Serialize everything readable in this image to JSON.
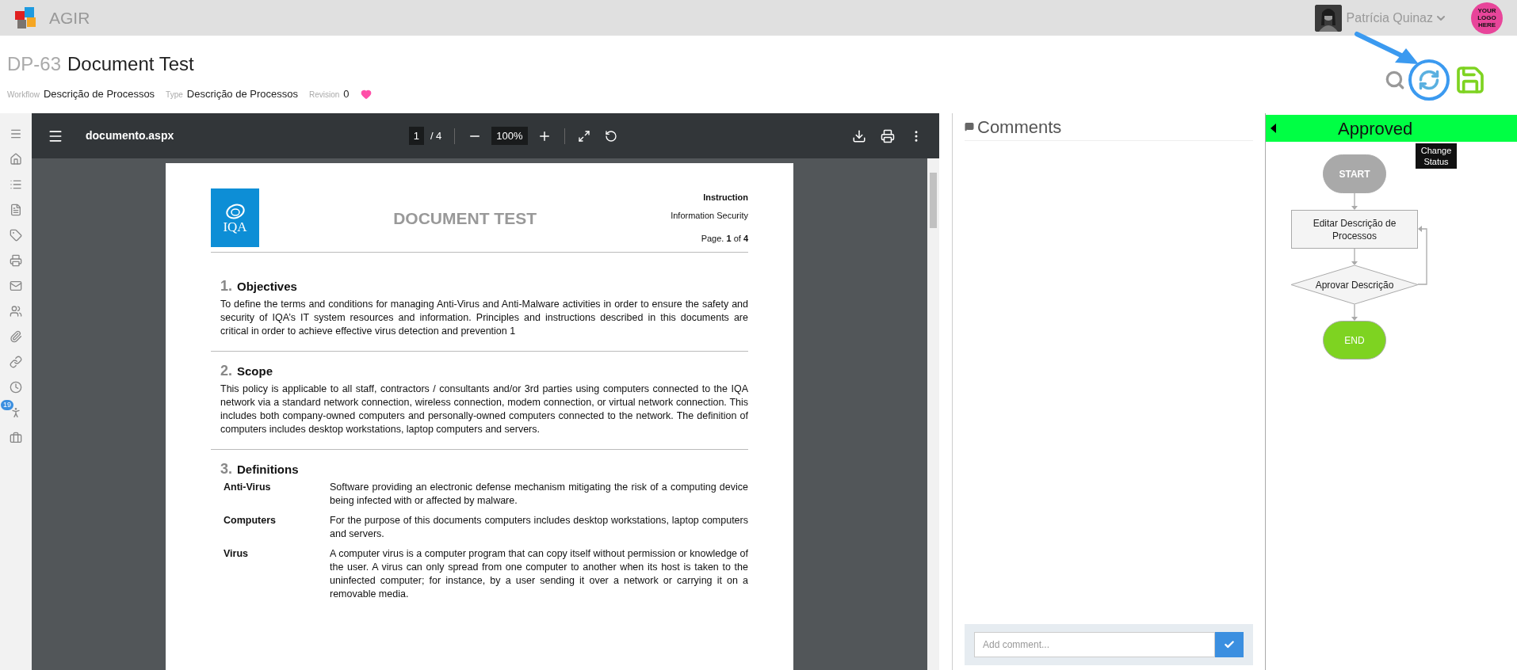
{
  "app": {
    "name": "AGIR"
  },
  "user": {
    "name": "Patrícia Quinaz"
  },
  "company_logo": {
    "lines": [
      "YOUR",
      "LOGO",
      "HERE"
    ]
  },
  "document": {
    "code": "DP-63",
    "title": "Document Test",
    "favorite": true,
    "meta": [
      {
        "label": "Workflow",
        "value": "Descrição de Processos"
      },
      {
        "label": "Type",
        "value": "Descrição de Processos"
      },
      {
        "label": "Revision",
        "value": "0"
      }
    ]
  },
  "actions": {
    "tooltip": "Change Status"
  },
  "sidebar": {
    "badge": "19"
  },
  "pdf_viewer": {
    "file_name": "documento.aspx",
    "page": "1",
    "page_count": "/ 4",
    "zoom": "100%"
  },
  "pdf_page": {
    "logo_text": "IQA",
    "title": "DOCUMENT TEST",
    "category": "Instruction",
    "subject": "Information Security",
    "page_label": "Page. **1** of **4**",
    "sections": [
      {
        "kind": "paragraph",
        "number": "1.",
        "title": "Objectives",
        "text": "To define the terms and conditions for managing Anti-Virus and Anti-Malware activities in order to ensure the safety and security of IQA’s IT system resources and information. Principles and instructions described in this documents are critical in order to achieve effective virus detection and prevention 1"
      },
      {
        "kind": "paragraph",
        "number": "2.",
        "title": "Scope",
        "text": "This policy is applicable to all staff, contractors / consultants and/or 3rd parties using computers connected to the IQA network via a standard network connection, wireless connection, modem connection, or virtual network connection. This includes both company-owned computers and personally-owned computers connected to the network. The definition of computers includes desktop workstations, laptop computers and servers."
      },
      {
        "kind": "definitions",
        "number": "3.",
        "title": "Definitions",
        "items": [
          {
            "term": "Anti-Virus",
            "definition": "Software providing an electronic defense mechanism mitigating the risk of a computing device being infected with or affected by malware."
          },
          {
            "term": "Computers",
            "definition": "For the purpose of this documents computers includes desktop workstations, laptop computers and servers."
          },
          {
            "term": "Virus",
            "definition": "A computer virus is a computer program that can copy itself without permission or knowledge of the user. A virus can only spread from one computer to another when its host is taken to the uninfected computer; for instance, by a user sending it over a network or carrying it on a removable media."
          }
        ]
      }
    ]
  },
  "comments": {
    "title": "Comments",
    "placeholder": "Add comment..."
  },
  "workflow": {
    "status": "Approved",
    "nodes": [
      {
        "kind": "start",
        "label": "START"
      },
      {
        "kind": "task",
        "label": "Editar Descrição de Processos"
      },
      {
        "kind": "decision",
        "label": "Aprovar Descrição"
      },
      {
        "kind": "end",
        "label": "END"
      }
    ]
  }
}
